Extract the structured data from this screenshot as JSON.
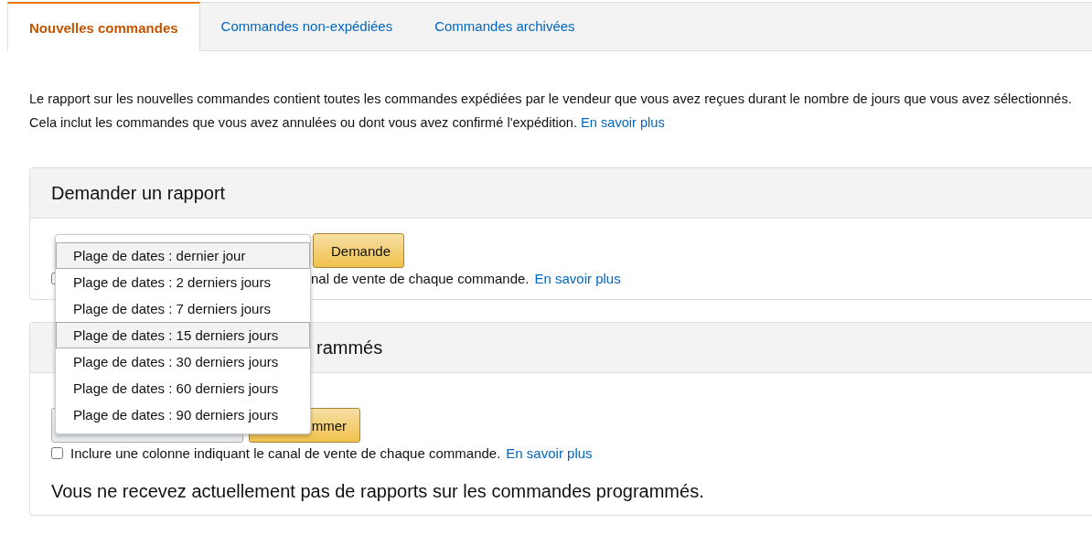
{
  "tabs": [
    {
      "label": "Nouvelles commandes",
      "selected": true
    },
    {
      "label": "Commandes non-expédiées",
      "selected": false
    },
    {
      "label": "Commandes archivées",
      "selected": false
    }
  ],
  "description": {
    "text": "Le rapport sur les nouvelles commandes contient toutes les commandes expédiées par le vendeur que vous avez reçues durant le nombre de jours que vous avez sélectionnés. Cela inclut les commandes que vous avez annulées ou dont vous avez confirmé l'expédition.",
    "link": "En savoir plus"
  },
  "request_panel": {
    "title": "Demander un rapport",
    "button": "Demande",
    "checkbox": {
      "checked": false,
      "label": "nal de vente de chaque commande.",
      "link": "En savoir plus"
    }
  },
  "scheduled_panel": {
    "title": "rammés",
    "button": "mmer",
    "checkbox": {
      "checked": false,
      "label": "Inclure une colonne indiquant le canal de vente de chaque commande.",
      "link": "En savoir plus"
    },
    "message": "Vous ne recevez actuellement pas de rapports sur les commandes programmés."
  },
  "dropdown": {
    "options": [
      {
        "label": "Plage de dates : dernier jour",
        "highlighted": true
      },
      {
        "label": "Plage de dates : 2 derniers jours",
        "highlighted": false
      },
      {
        "label": "Plage de dates : 7 derniers jours",
        "highlighted": false
      },
      {
        "label": "Plage de dates : 15 derniers jours",
        "highlighted": true
      },
      {
        "label": "Plage de dates : 30 derniers jours",
        "highlighted": false
      },
      {
        "label": "Plage de dates : 60 derniers jours",
        "highlighted": false
      },
      {
        "label": "Plage de dates : 90 derniers jours",
        "highlighted": false
      }
    ]
  }
}
